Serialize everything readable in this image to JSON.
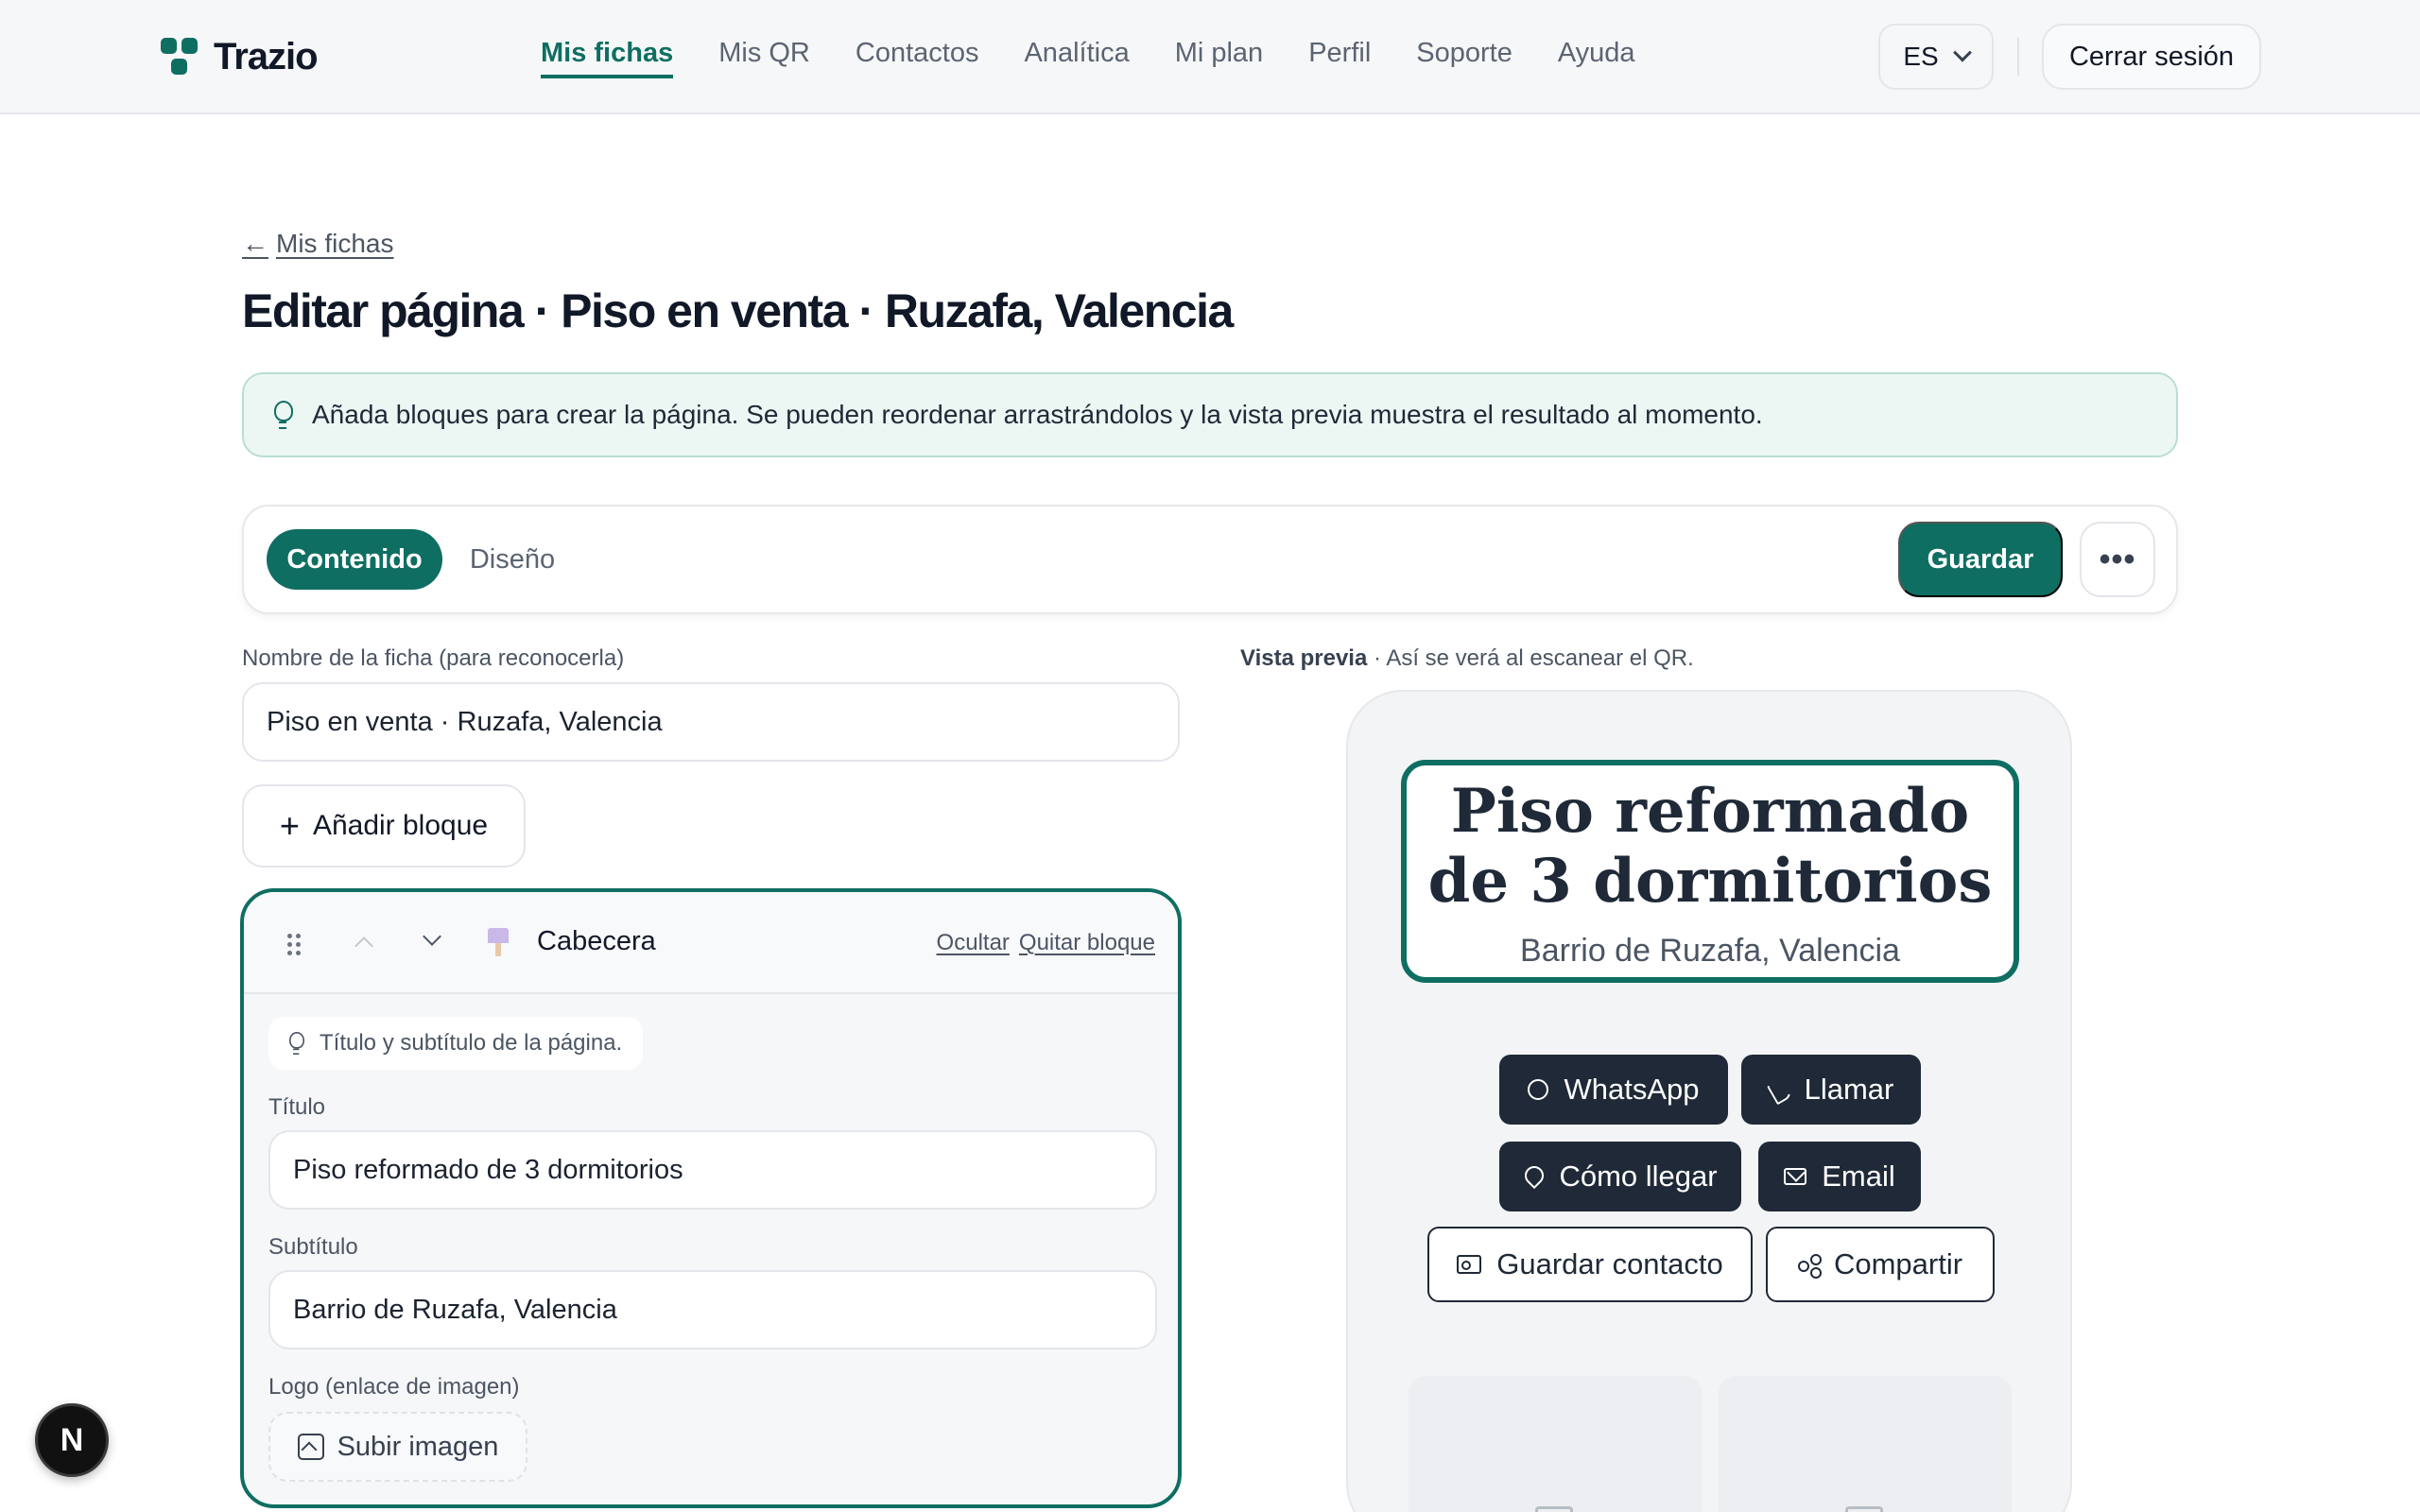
{
  "app": {
    "brand": "Trazio",
    "nav": [
      "Mis fichas",
      "Mis QR",
      "Contactos",
      "Analítica",
      "Mi plan",
      "Perfil",
      "Soporte",
      "Ayuda"
    ],
    "active_nav": "Mis fichas",
    "language": "ES",
    "logout_label": "Cerrar sesión",
    "accent_color": "#0f6e62"
  },
  "page": {
    "back_label": "Mis fichas",
    "back_arrow": "←",
    "title": "Editar página · Piso en venta · Ruzafa, Valencia",
    "tip": "Añada bloques para crear la página. Se pueden reordenar arrastrándolos y la vista previa muestra el resultado al momento."
  },
  "toolbar": {
    "tabs": [
      "Contenido",
      "Diseño"
    ],
    "active_tab": "Contenido",
    "save_label": "Guardar",
    "more_label": "•••"
  },
  "editor": {
    "name_label": "Nombre de la ficha (para reconocerla)",
    "name_value": "Piso en venta · Ruzafa, Valencia",
    "add_block_label": "Añadir bloque",
    "block": {
      "title": "Cabecera",
      "hide_label": "Ocultar",
      "remove_label": "Quitar bloque",
      "hint": "Título y subtítulo de la página.",
      "title_label": "Título",
      "title_value": "Piso reformado de 3 dormitorios",
      "subtitle_label": "Subtítulo",
      "subtitle_value": "Barrio de Ruzafa, Valencia",
      "logo_label": "Logo (enlace de imagen)",
      "upload_label": "Subir imagen"
    }
  },
  "preview": {
    "label_bold": "Vista previa",
    "label_rest": " · Así se verá al escanear el QR.",
    "hero_title": "Piso reformado de 3 dormitorios",
    "hero_subtitle": "Barrio de Ruzafa, Valencia",
    "buttons": {
      "whatsapp": "WhatsApp",
      "call": "Llamar",
      "directions": "Cómo llegar",
      "email": "Email",
      "save_contact": "Guardar contacto",
      "share": "Compartir"
    }
  },
  "dev_badge": "N"
}
